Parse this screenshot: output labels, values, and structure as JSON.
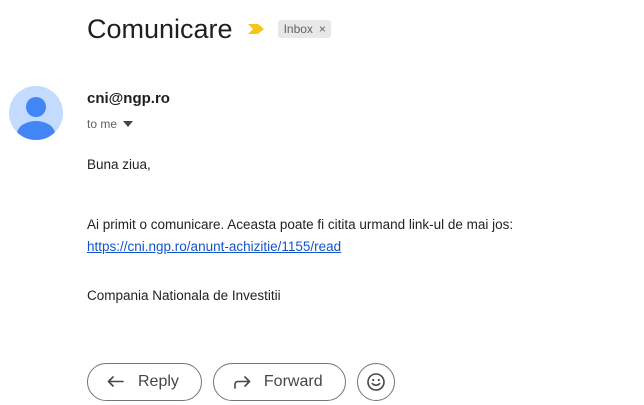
{
  "subject": "Comunicare",
  "label": {
    "text": "Inbox",
    "remove_glyph": "×"
  },
  "sender": {
    "email": "cni@ngp.ro",
    "recipient_text": "to me"
  },
  "body": {
    "greeting": "Buna ziua,",
    "message": "Ai primit o comunicare. Aceasta poate fi citita urmand link-ul de mai jos:",
    "link": "https://cni.ngp.ro/anunt-achizitie/1155/read",
    "signoff": "Compania Nationala de Investitii"
  },
  "actions": {
    "reply_label": "Reply",
    "forward_label": "Forward"
  },
  "icons": {
    "importance": "importance-marker-icon",
    "avatar": "default-avatar-icon",
    "caret": "caret-down-icon",
    "reply": "reply-arrow-icon",
    "forward": "forward-arrow-icon",
    "emoji": "emoji-smile-icon"
  },
  "colors": {
    "importance": "#f5c518",
    "avatar_bg": "#c2dbff",
    "avatar_fg": "#4285f4",
    "link": "#1155cc",
    "chip_bg": "#e8e8e8"
  }
}
